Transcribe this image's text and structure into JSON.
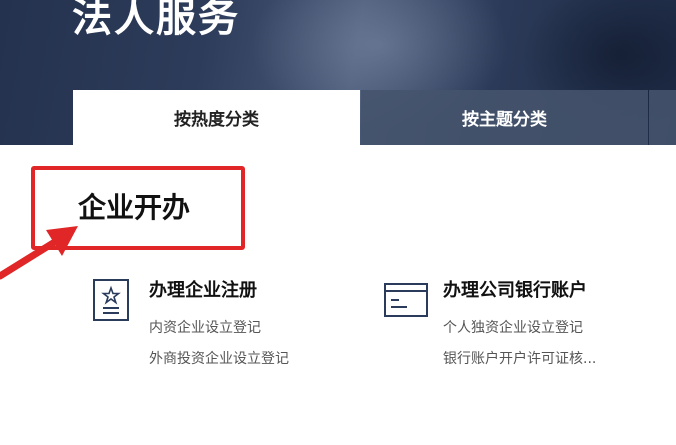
{
  "hero": {
    "title": "法人服务"
  },
  "tabs": [
    {
      "label": "按热度分类",
      "active": true
    },
    {
      "label": "按主题分类",
      "active": false
    }
  ],
  "section": {
    "title": "企业开办"
  },
  "services": [
    {
      "icon": "certificate-icon",
      "title": "办理企业注册",
      "links": [
        "内资企业设立登记",
        "外商投资企业设立登记"
      ]
    },
    {
      "icon": "bank-card-icon",
      "title": "办理公司银行账户",
      "links": [
        "个人独资企业设立登记",
        "银行账户开户许可证核..."
      ]
    }
  ],
  "colors": {
    "hero_bg": "#2d3c5a",
    "tab_inactive": "#46546c",
    "highlight": "#e02626",
    "icon_stroke": "#2a3b5c"
  }
}
